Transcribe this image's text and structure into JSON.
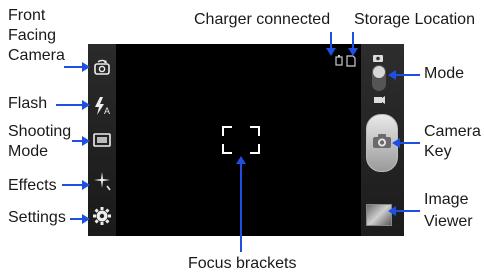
{
  "labels": {
    "front_facing_camera_line1": "Front",
    "front_facing_camera_line2": "Facing",
    "front_facing_camera_line3": "Camera",
    "flash": "Flash",
    "shooting_mode_line1": "Shooting",
    "shooting_mode_line2": "Mode",
    "effects": "Effects",
    "settings": "Settings",
    "charger_connected": "Charger connected",
    "storage_location": "Storage Location",
    "mode": "Mode",
    "camera_key_line1": "Camera",
    "camera_key_line2": "Key",
    "image_viewer_line1": "Image",
    "image_viewer_line2": "Viewer",
    "focus_brackets": "Focus brackets"
  },
  "icons": {
    "front_camera": "switch-camera-icon",
    "flash": "flash-auto-icon",
    "shooting_mode": "shooting-mode-icon",
    "effects": "effects-sparkle-icon",
    "settings": "gear-icon",
    "charger": "charger-icon",
    "storage": "storage-card-icon",
    "mode_camera": "camera-mode-icon",
    "mode_video": "video-mode-icon",
    "camera_key": "camera-shutter-icon",
    "image_viewer": "image-thumbnail-icon"
  },
  "colors": {
    "callout_line": "#1f4fe0",
    "screen_background": "#000000"
  }
}
